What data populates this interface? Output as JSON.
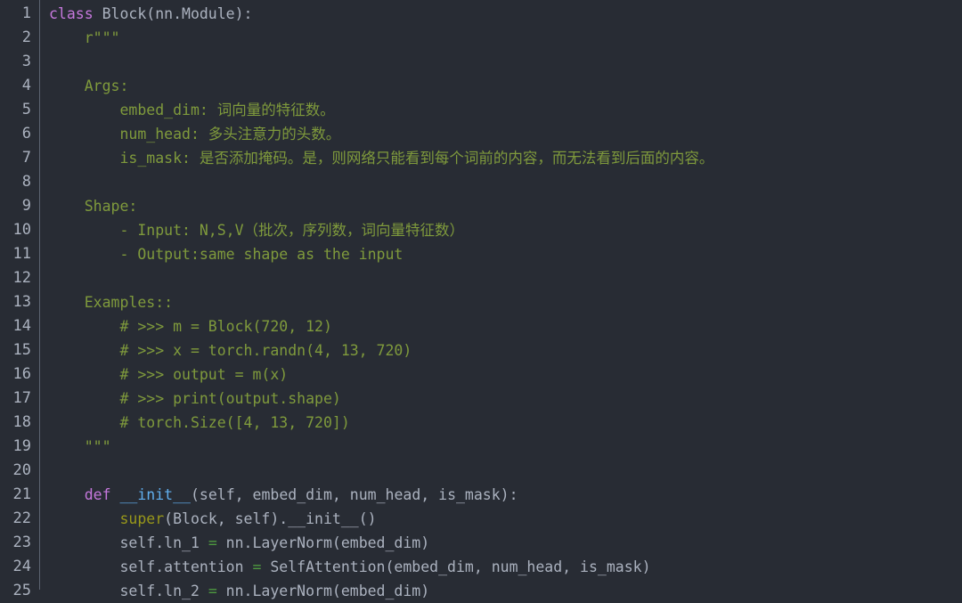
{
  "editor": {
    "language": "python",
    "background_color": "#282c34",
    "gutter_color": "#abb2bf",
    "divider_color": "#5c6370",
    "foreground_color": "#abb2bf",
    "colors": {
      "keyword": "#c678dd",
      "function_name": "#61afef",
      "docstring": "#7f9a3c",
      "comment": "#7f9a3c",
      "builtin": "#98971a",
      "operator": "#4e9a3f",
      "plain": "#abb2bf"
    },
    "first_visible_line": 1,
    "last_visible_line": 25
  },
  "lines": [
    {
      "number": "1",
      "tokens": [
        {
          "t": "class",
          "c": "kw"
        },
        {
          "t": " Block(nn.Module):",
          "c": "plain"
        }
      ]
    },
    {
      "number": "2",
      "tokens": [
        {
          "t": "    r\"\"\"",
          "c": "doc"
        }
      ]
    },
    {
      "number": "3",
      "tokens": [
        {
          "t": "",
          "c": "doc"
        }
      ]
    },
    {
      "number": "4",
      "tokens": [
        {
          "t": "    Args:",
          "c": "doc"
        }
      ]
    },
    {
      "number": "5",
      "tokens": [
        {
          "t": "        embed_dim: 词向量的特征数。",
          "c": "doc"
        }
      ]
    },
    {
      "number": "6",
      "tokens": [
        {
          "t": "        num_head: 多头注意力的头数。",
          "c": "doc"
        }
      ]
    },
    {
      "number": "7",
      "tokens": [
        {
          "t": "        is_mask: 是否添加掩码。是，则网络只能看到每个词前的内容，而无法看到后面的内容。",
          "c": "doc"
        }
      ]
    },
    {
      "number": "8",
      "tokens": [
        {
          "t": "",
          "c": "doc"
        }
      ]
    },
    {
      "number": "9",
      "tokens": [
        {
          "t": "    Shape:",
          "c": "doc"
        }
      ]
    },
    {
      "number": "10",
      "tokens": [
        {
          "t": "        - Input: N,S,V（批次，序列数，词向量特征数）",
          "c": "doc"
        }
      ]
    },
    {
      "number": "11",
      "tokens": [
        {
          "t": "        - Output:same shape as the input",
          "c": "doc"
        }
      ]
    },
    {
      "number": "12",
      "tokens": [
        {
          "t": "",
          "c": "doc"
        }
      ]
    },
    {
      "number": "13",
      "tokens": [
        {
          "t": "    Examples::",
          "c": "doc"
        }
      ]
    },
    {
      "number": "14",
      "tokens": [
        {
          "t": "        # >>> m = Block(720, 12)",
          "c": "doc"
        }
      ]
    },
    {
      "number": "15",
      "tokens": [
        {
          "t": "        # >>> x = torch.randn(4, 13, 720)",
          "c": "doc"
        }
      ]
    },
    {
      "number": "16",
      "tokens": [
        {
          "t": "        # >>> output = m(x)",
          "c": "doc"
        }
      ]
    },
    {
      "number": "17",
      "tokens": [
        {
          "t": "        # >>> print(output.shape)",
          "c": "doc"
        }
      ]
    },
    {
      "number": "18",
      "tokens": [
        {
          "t": "        # torch.Size([4, 13, 720])",
          "c": "doc"
        }
      ]
    },
    {
      "number": "19",
      "tokens": [
        {
          "t": "    \"\"\"",
          "c": "doc"
        }
      ]
    },
    {
      "number": "20",
      "tokens": [
        {
          "t": "",
          "c": "plain"
        }
      ]
    },
    {
      "number": "21",
      "tokens": [
        {
          "t": "    ",
          "c": "plain"
        },
        {
          "t": "def",
          "c": "kw"
        },
        {
          "t": " ",
          "c": "plain"
        },
        {
          "t": "__init__",
          "c": "fn"
        },
        {
          "t": "(self, embed_dim, num_head, is_mask):",
          "c": "plain"
        }
      ]
    },
    {
      "number": "22",
      "tokens": [
        {
          "t": "        ",
          "c": "plain"
        },
        {
          "t": "super",
          "c": "builtin"
        },
        {
          "t": "(Block, self).__init__()",
          "c": "plain"
        }
      ]
    },
    {
      "number": "23",
      "tokens": [
        {
          "t": "        self.ln_1 ",
          "c": "plain"
        },
        {
          "t": "=",
          "c": "op"
        },
        {
          "t": " nn.LayerNorm(embed_dim)",
          "c": "plain"
        }
      ]
    },
    {
      "number": "24",
      "tokens": [
        {
          "t": "        self.attention ",
          "c": "plain"
        },
        {
          "t": "=",
          "c": "op"
        },
        {
          "t": " SelfAttention(embed_dim, num_head, is_mask)",
          "c": "plain"
        }
      ]
    },
    {
      "number": "25",
      "tokens": [
        {
          "t": "        self.ln_2 ",
          "c": "plain"
        },
        {
          "t": "=",
          "c": "op"
        },
        {
          "t": " nn.LayerNorm(embed_dim)",
          "c": "plain"
        }
      ]
    }
  ]
}
